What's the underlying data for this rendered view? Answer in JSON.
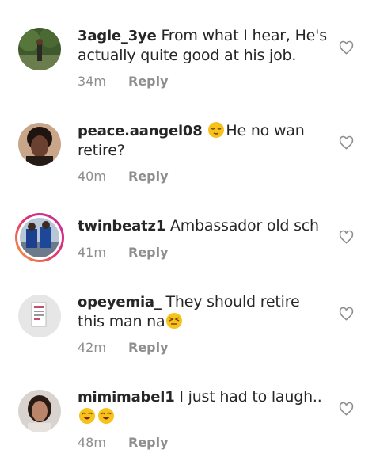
{
  "comments": [
    {
      "username": "3agle_3ye",
      "text": "From what I hear, He's actually quite good at his job.",
      "time": "34m",
      "reply": "Reply"
    },
    {
      "username": "peace.aangel08",
      "emoji_before": "relieved-face-emoji",
      "text": "He no wan retire?",
      "time": "40m",
      "reply": "Reply"
    },
    {
      "username": "twinbeatz1",
      "text": "Ambassador old sch",
      "time": "41m",
      "reply": "Reply"
    },
    {
      "username": "opeyemia_",
      "text": "They should retire this man na",
      "emoji_after": "squinting-face-emoji",
      "time": "42m",
      "reply": "Reply"
    },
    {
      "username": "mimimabel1",
      "text": "I just had to laugh..",
      "emoji_after": "grinning-face-emoji x2",
      "time": "48m",
      "reply": "Reply"
    }
  ]
}
